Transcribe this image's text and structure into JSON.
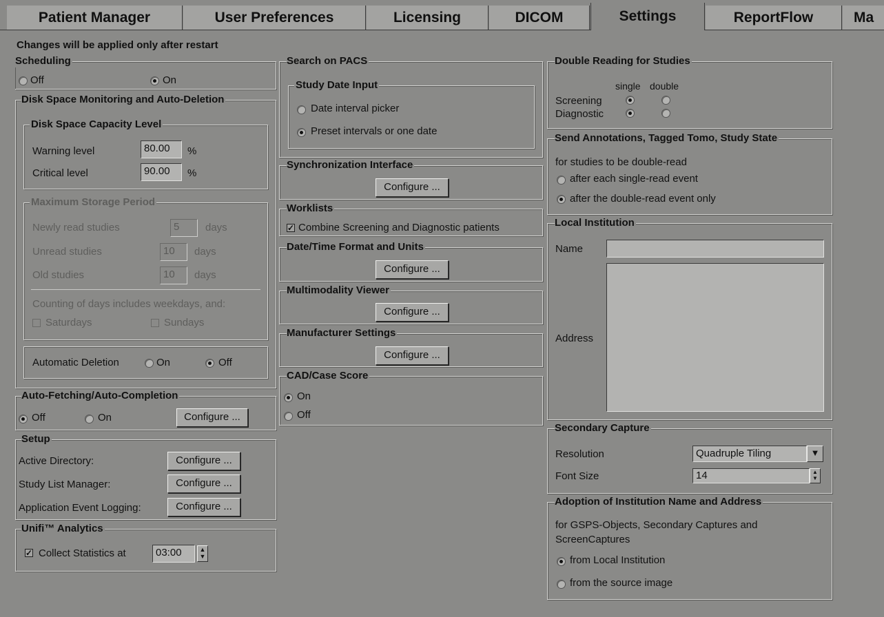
{
  "tabs": [
    "Patient Manager",
    "User Preferences",
    "Licensing",
    "DICOM",
    "Settings",
    "ReportFlow",
    "Ma"
  ],
  "notice": "Changes will be applied only after restart",
  "scheduling": {
    "title": "Scheduling",
    "off": "Off",
    "on": "On",
    "selected": "On"
  },
  "disk": {
    "title": "Disk Space Monitoring and Auto-Deletion",
    "capacity": {
      "title": "Disk Space Capacity Level",
      "warning_label": "Warning level",
      "warning_value": "80.00",
      "warning_unit": "%",
      "critical_label": "Critical level",
      "critical_value": "90.00",
      "critical_unit": "%"
    },
    "storage": {
      "title": "Maximum Storage Period",
      "newly_label": "Newly read studies",
      "newly_value": "5",
      "unread_label": "Unread studies",
      "unread_value": "10",
      "old_label": "Old studies",
      "old_value": "10",
      "days": "days",
      "counting": "Counting of days includes weekdays, and:",
      "saturdays": "Saturdays",
      "sundays": "Sundays"
    },
    "auto_delete": {
      "label": "Automatic Deletion",
      "on": "On",
      "off": "Off",
      "selected": "Off"
    }
  },
  "autofetch": {
    "title": "Auto-Fetching/Auto-Completion",
    "off": "Off",
    "on": "On",
    "selected": "Off",
    "configure": "Configure ..."
  },
  "setup": {
    "title": "Setup",
    "rows": [
      {
        "label": "Active Directory:",
        "button": "Configure ..."
      },
      {
        "label": "Study List Manager:",
        "button": "Configure ..."
      },
      {
        "label": "Application Event Logging:",
        "button": "Configure ..."
      }
    ]
  },
  "analytics": {
    "title": "Unifi™ Analytics",
    "collect_label": "Collect Statistics at",
    "checked": true,
    "time": "03:00"
  },
  "pacs": {
    "title": "Search on PACS",
    "date_input": {
      "title": "Study Date Input",
      "picker": "Date interval picker",
      "preset": "Preset intervals or one date",
      "selected": "preset"
    }
  },
  "sync": {
    "title": "Synchronization Interface",
    "configure": "Configure ..."
  },
  "worklists": {
    "title": "Worklists",
    "combine": "Combine Screening and Diagnostic patients",
    "checked": true
  },
  "datetime": {
    "title": "Date/Time Format and Units",
    "configure": "Configure ..."
  },
  "mmv": {
    "title": "Multimodality Viewer",
    "configure": "Configure ..."
  },
  "manufacturer": {
    "title": "Manufacturer Settings",
    "configure": "Configure ..."
  },
  "cad": {
    "title": "CAD/Case Score",
    "on": "On",
    "off": "Off",
    "selected": "On"
  },
  "double": {
    "title": "Double Reading for Studies",
    "single": "single",
    "double": "double",
    "screening": "Screening",
    "diagnostic": "Diagnostic",
    "screening_selected": "single",
    "diagnostic_selected": "single"
  },
  "send": {
    "title": "Send Annotations, Tagged Tomo, Study State",
    "desc": "for studies to be double-read",
    "after_each": "after each single-read event",
    "after_double": "after the double-read event only",
    "selected": "after_double"
  },
  "institution": {
    "title": "Local Institution",
    "name_label": "Name",
    "name_value": "",
    "address_label": "Address",
    "address_value": ""
  },
  "secondary": {
    "title": "Secondary Capture",
    "resolution_label": "Resolution",
    "resolution_value": "Quadruple Tiling",
    "font_label": "Font Size",
    "font_value": "14"
  },
  "adoption": {
    "title": "Adoption of Institution Name and Address",
    "desc1": "for GSPS-Objects, Secondary Captures and",
    "desc2": "ScreenCaptures",
    "from_local": "from Local Institution",
    "from_source": "from the source image",
    "selected": "from_local"
  }
}
